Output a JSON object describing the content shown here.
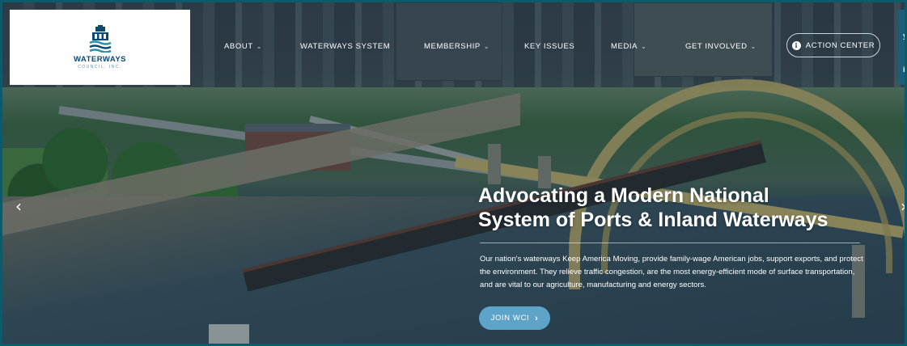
{
  "logo": {
    "name": "WATERWAYS",
    "subtitle": "COUNCIL, INC."
  },
  "nav": {
    "items": [
      {
        "label": "ABOUT",
        "has_dropdown": true
      },
      {
        "label": "WATERWAYS SYSTEM",
        "has_dropdown": false
      },
      {
        "label": "MEMBERSHIP",
        "has_dropdown": true
      },
      {
        "label": "KEY ISSUES",
        "has_dropdown": false
      },
      {
        "label": "MEDIA",
        "has_dropdown": true
      },
      {
        "label": "GET INVOLVED",
        "has_dropdown": true
      }
    ],
    "action_center": "ACTION CENTER",
    "chevron": "⌄"
  },
  "side_panel": {
    "glyphs": [
      "y",
      "i"
    ]
  },
  "hero": {
    "headline_line1": "Advocating a Modern National",
    "headline_line2": "System of Ports & Inland Waterways",
    "paragraph": "Our nation's waterways Keep America Moving, provide family-wage American jobs, support exports, and protect the environment. They relieve traffic congestion, are the most energy-efficient mode of surface transportation, and are vital to our agriculture, manufacturing and energy sectors.",
    "cta_label": "JOIN WCI",
    "cta_arrow": "›"
  },
  "carousel": {
    "prev": "‹",
    "next": "›"
  },
  "colors": {
    "brand_navy": "#0c4a6e",
    "cta_blue": "#5ea3c8",
    "bridge_yellow": "#c9b46a"
  }
}
